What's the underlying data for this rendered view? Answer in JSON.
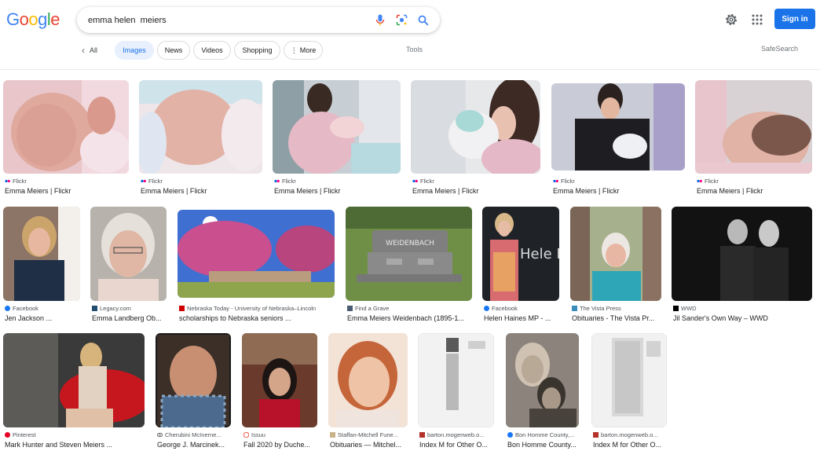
{
  "header": {
    "logo_text": "Google",
    "search_value": "emma helen  meiers",
    "signin_label": "Sign in"
  },
  "tabs": {
    "all": "All",
    "images": "Images",
    "news": "News",
    "videos": "Videos",
    "shopping": "Shopping",
    "more": "More",
    "tools": "Tools",
    "safesearch": "SafeSearch"
  },
  "results": [
    {
      "source": "Flickr",
      "title": "Emma Meiers | Flickr"
    },
    {
      "source": "Flickr",
      "title": "Emma Meiers | Flickr"
    },
    {
      "source": "Flickr",
      "title": "Emma Meiers | Flickr"
    },
    {
      "source": "Flickr",
      "title": "Emma Meiers | Flickr"
    },
    {
      "source": "Flickr",
      "title": "Emma Meiers | Flickr"
    },
    {
      "source": "Flickr",
      "title": "Emma Meiers | Flickr"
    },
    {
      "source": "Facebook",
      "title": "Jen Jackson ..."
    },
    {
      "source": "Legacy.com",
      "title": "Emma Landberg Ob..."
    },
    {
      "source": "Nebraska Today - University of Nebraska–Lincoln",
      "title": "scholarships to Nebraska seniors ..."
    },
    {
      "source": "Find a Grave",
      "title": "Emma Meiers Weidenbach (1895-1..."
    },
    {
      "source": "Facebook",
      "title": "Helen Haines MP - ..."
    },
    {
      "source": "The Vista Press",
      "title": "Obituaries - The Vista Pr..."
    },
    {
      "source": "WWD",
      "title": "Jil Sander's Own Way – WWD"
    },
    {
      "source": "Pinterest",
      "title": "Mark Hunter and Steven Meiers ..."
    },
    {
      "source": "Cherubini McInerne...",
      "title": "George J. Marcinek..."
    },
    {
      "source": "Issuu",
      "title": "Fall 2020 by Duche..."
    },
    {
      "source": "Staffan-Mitchell Fune...",
      "title": "Obituaries — Mitchel..."
    },
    {
      "source": "barton.mogenweb.o...",
      "title": "Index M for Other O..."
    },
    {
      "source": "Bon Homme County,...",
      "title": "Bon Homme County..."
    },
    {
      "source": "barton.mogenweb.o...",
      "title": "Index M for Other O..."
    }
  ],
  "thumb_text": {
    "headstone": "WEIDENBACH",
    "helen_hains": "Hele Hain"
  },
  "colors": {
    "accent": "#1a73e8",
    "chip_active_bg": "#e8f0fe"
  }
}
